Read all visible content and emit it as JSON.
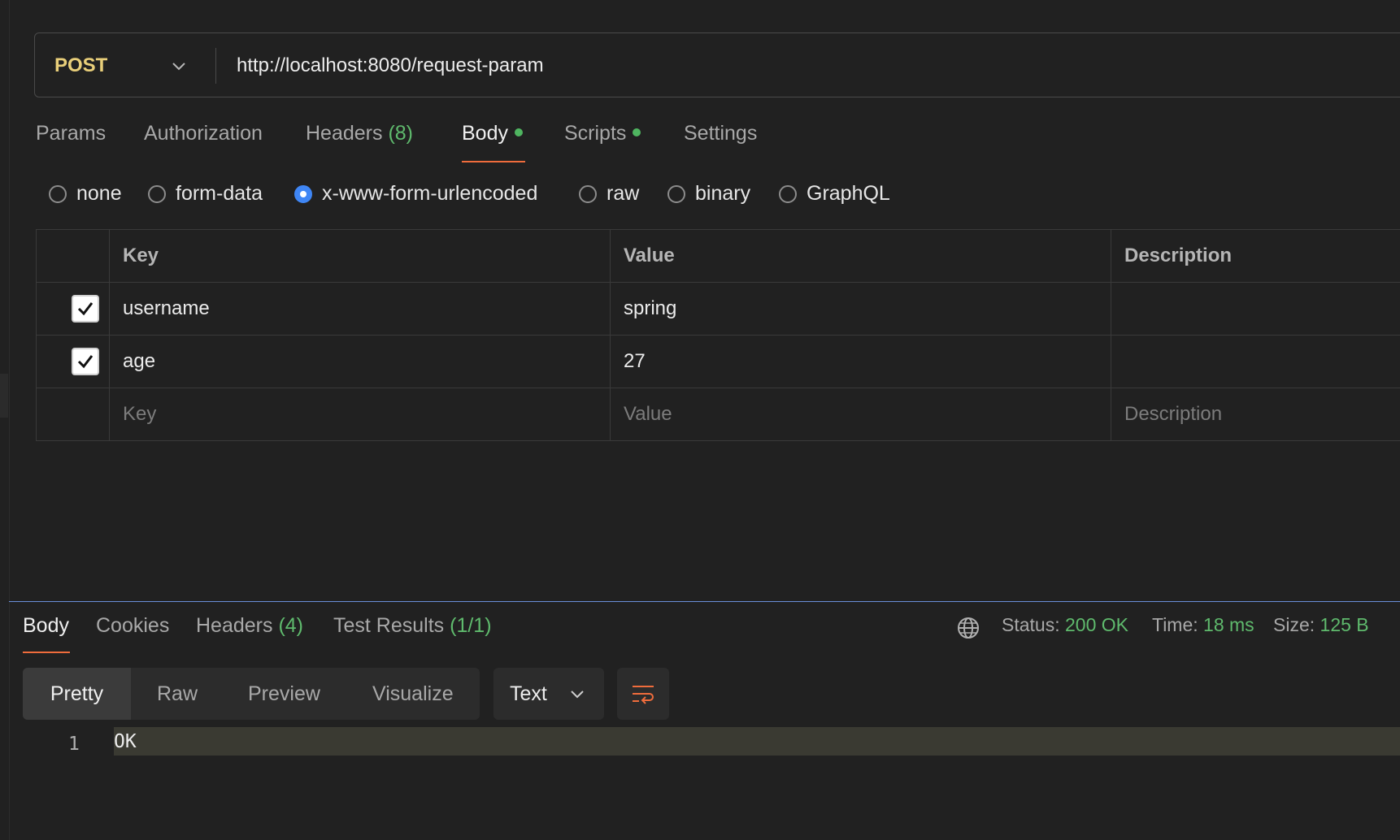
{
  "request": {
    "method": "POST",
    "url": "http://localhost:8080/request-param"
  },
  "request_tabs": [
    {
      "label": "Params"
    },
    {
      "label": "Authorization"
    },
    {
      "label": "Headers",
      "count": "(8)"
    },
    {
      "label": "Body",
      "active": true,
      "indicator": true
    },
    {
      "label": "Scripts",
      "indicator": true
    },
    {
      "label": "Settings"
    }
  ],
  "body_types": [
    {
      "label": "none"
    },
    {
      "label": "form-data"
    },
    {
      "label": "x-www-form-urlencoded",
      "selected": true
    },
    {
      "label": "raw"
    },
    {
      "label": "binary"
    },
    {
      "label": "GraphQL"
    }
  ],
  "table": {
    "headers": {
      "key": "Key",
      "value": "Value",
      "description": "Description"
    },
    "rows": [
      {
        "checked": true,
        "key": "username",
        "value": "spring",
        "description": ""
      },
      {
        "checked": true,
        "key": "age",
        "value": "27",
        "description": ""
      }
    ],
    "placeholder": {
      "key": "Key",
      "value": "Value",
      "description": "Description"
    }
  },
  "response_tabs": [
    {
      "label": "Body",
      "active": true
    },
    {
      "label": "Cookies"
    },
    {
      "label": "Headers",
      "count": "(4)"
    },
    {
      "label": "Test Results",
      "count": "(1/1)"
    }
  ],
  "response_meta": {
    "status_label": "Status:",
    "status_value": "200 OK",
    "time_label": "Time:",
    "time_value": "18 ms",
    "size_label": "Size:",
    "size_value": "125 B"
  },
  "format": {
    "views": [
      "Pretty",
      "Raw",
      "Preview",
      "Visualize"
    ],
    "active_view": "Pretty",
    "type": "Text"
  },
  "code": {
    "line_number": "1",
    "content": "OK"
  },
  "colors": {
    "method": "#e9cf7a",
    "accent": "#ef6c3c",
    "success": "#5fba6d",
    "radio": "#3f86f5"
  },
  "icons": {
    "method_dropdown": "chevron-down-icon",
    "globe": "globe-icon",
    "wrap": "wrap-lines-icon",
    "check": "check-icon"
  }
}
